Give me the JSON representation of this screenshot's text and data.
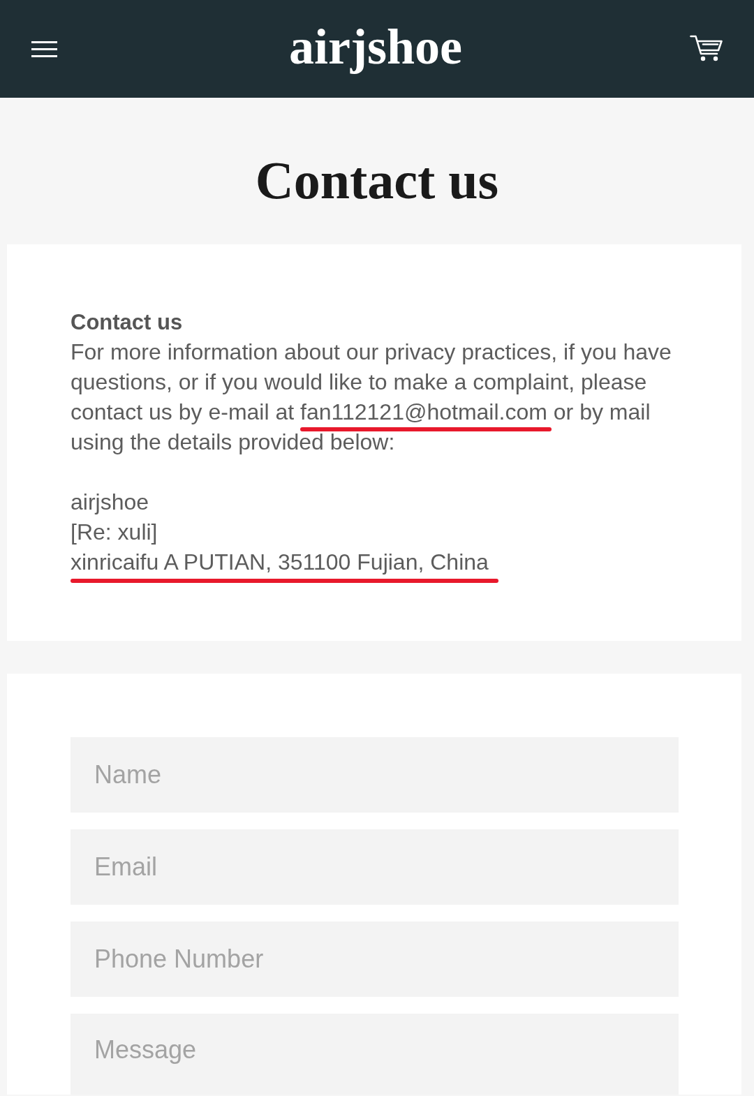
{
  "header": {
    "logo": "airjshoe"
  },
  "page_title": "Contact us",
  "contact_info": {
    "heading": "Contact us",
    "text_before": "For more information about our privacy practices, if you have questions, or if you would like to make a complaint, please contact us by e-mail at ",
    "email": {
      "text": "fan112121@hotmail.com",
      "annotated": true
    },
    "text_after": " or by mail using the details provided below:",
    "address_lines": [
      {
        "text": "airjshoe",
        "annotated": false
      },
      {
        "text": "[Re: xuli]",
        "annotated": false
      },
      {
        "text": "xinricaifu A PUTIAN, 351100 Fujian, China",
        "annotated": true
      }
    ]
  },
  "form": {
    "fields": [
      {
        "kind": "input",
        "placeholder": "Name"
      },
      {
        "kind": "input",
        "placeholder": "Email"
      },
      {
        "kind": "input",
        "placeholder": "Phone Number"
      },
      {
        "kind": "textarea",
        "placeholder": "Message"
      }
    ]
  }
}
